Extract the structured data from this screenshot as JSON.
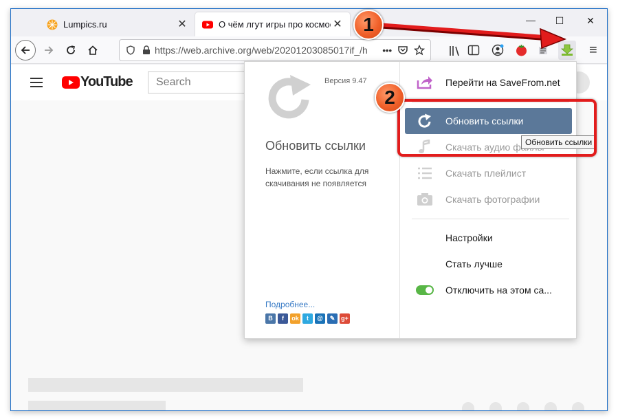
{
  "tabs": [
    {
      "title": "Lumpics.ru",
      "close": "✕"
    },
    {
      "title": "О чём лгут игры про космос",
      "close": "✕"
    }
  ],
  "window_controls": {
    "minimize": "—",
    "maximize": "☐",
    "close": "✕"
  },
  "navbar": {
    "url": "https://web.archive.org/web/20201203085017if_/h",
    "more": "•••",
    "menu_glyph": "≡"
  },
  "page": {
    "brand": "YouTube",
    "search_placeholder": "Search"
  },
  "popup": {
    "version": "Версия 9.47",
    "big_title": "Обновить ссылки",
    "hint": "Нажмите, если ссылка для скачивания не появляется",
    "more_link": "Подробнее...",
    "social": [
      {
        "icon": "vk-icon",
        "glyph": "В",
        "color": "#4a76a8"
      },
      {
        "icon": "facebook-icon",
        "glyph": "f",
        "color": "#3b5998"
      },
      {
        "icon": "odnoklassniki-icon",
        "glyph": "ok",
        "color": "#f2a12b"
      },
      {
        "icon": "twitter-icon",
        "glyph": "t",
        "color": "#2fa9e0"
      },
      {
        "icon": "mailru-icon",
        "glyph": "@",
        "color": "#1a73b8"
      },
      {
        "icon": "livejournal-icon",
        "glyph": "✎",
        "color": "#2a6db3"
      },
      {
        "icon": "googleplus-icon",
        "glyph": "g+",
        "color": "#dd4b39"
      }
    ],
    "menu": {
      "goto_savefrom": "Перейти на SaveFrom.net",
      "refresh_links": "Обновить ссылки",
      "download_audio": "Скачать аудио файлы",
      "download_playlist": "Скачать плейлист",
      "download_photos": "Скачать фотографии",
      "settings": "Настройки",
      "improve": "Стать лучше",
      "disable_site": "Отключить на этом са..."
    }
  },
  "tooltip": "Обновить ссылки",
  "annotations": {
    "step1": "1",
    "step2": "2"
  },
  "colors": {
    "accent_active": "#5b7899",
    "highlight": "#e21c1c",
    "badge": "#f0602a",
    "toggle_on": "#58b646"
  }
}
